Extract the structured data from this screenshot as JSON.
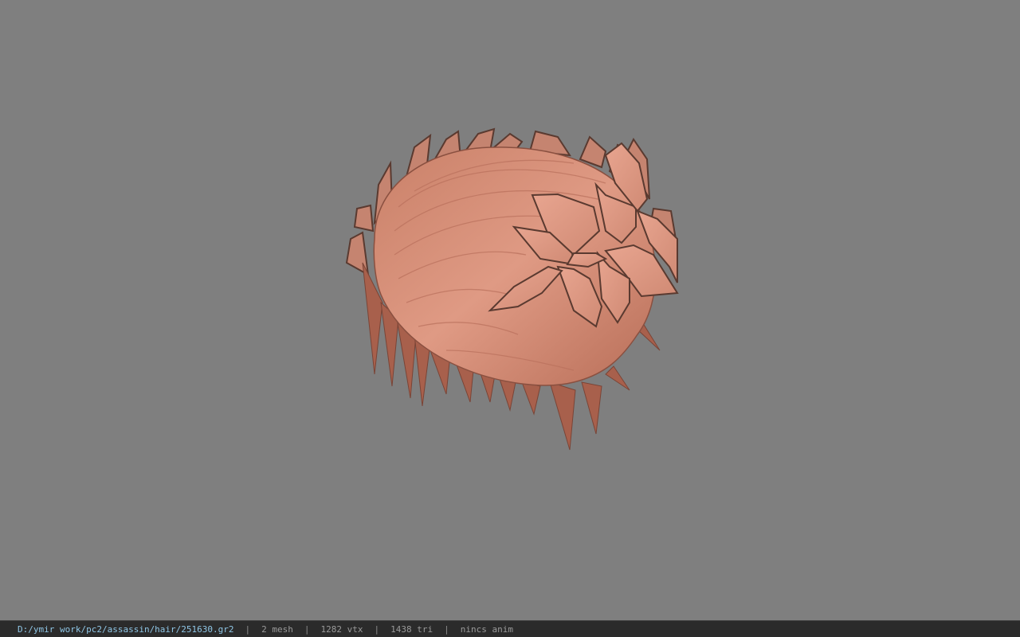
{
  "viewport": {
    "background_color": "#7f7f7f",
    "model_subject": "hair mesh with leaf ornaments",
    "model_color": "#d8907c"
  },
  "statusbar": {
    "file_path": "D:/ymir work/pc2/assassin/hair/251630.gr2",
    "separator": "|",
    "mesh_count": "2 mesh",
    "vertex_count": "1282 vtx",
    "triangle_count": "1438 tri",
    "anim_status": "nincs anim",
    "path_color": "#8fc6e6"
  }
}
